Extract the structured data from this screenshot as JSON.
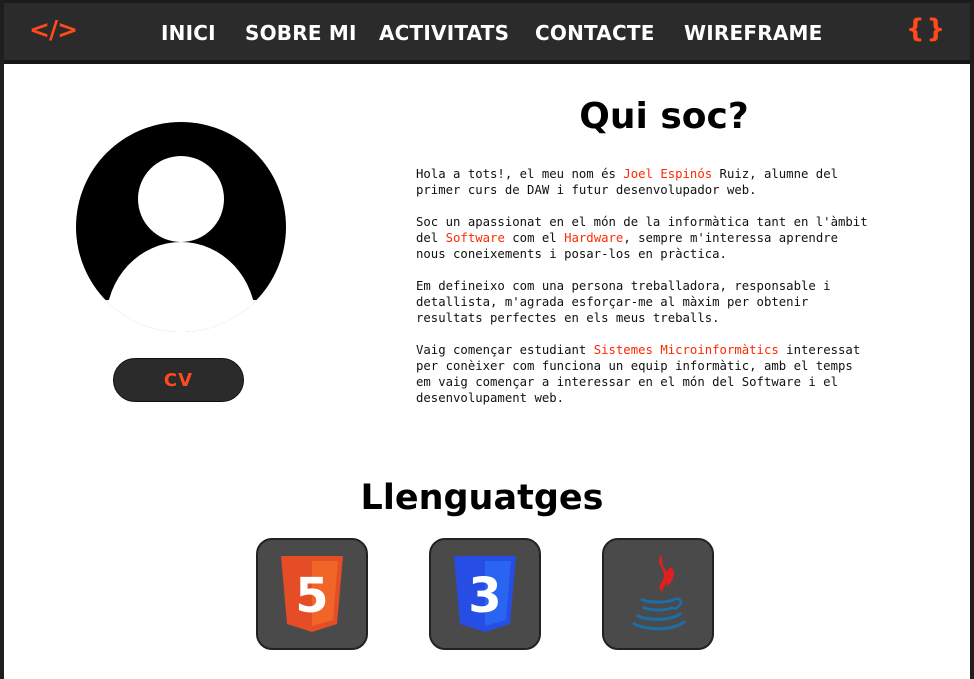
{
  "navbar": {
    "logo": "</>",
    "braces": "{}",
    "links": [
      "INICI",
      "SOBRE MI",
      "ACTIVITATS",
      "CONTACTE",
      "WIREFRAME"
    ]
  },
  "profile": {
    "cv_label": "CV"
  },
  "about": {
    "title": "Qui soc?",
    "p1": {
      "t1": "Hola a tots!, el meu nom és ",
      "name": "Joel Espinós",
      "t2": " Ruiz, alumne del",
      "line2": "primer curs de DAW i futur desenvolupador web."
    },
    "p2": {
      "line1": "Soc un apassionat en el món de la informàtica tant en l'àmbit",
      "t1": "del ",
      "software": "Software",
      "t2": " com el ",
      "hardware": "Hardware",
      "t3": ", sempre m'interessa aprendre",
      "line3": "nous coneixements i posar-los en pràctica."
    },
    "p3": {
      "line1": "Em defineixo com una persona treballadora, responsable i",
      "line2": "detallista, m'agrada esforçar-me al màxim per obtenir",
      "line3": "resultats perfectes en els meus treballs."
    },
    "p4": {
      "t1": "Vaig començar estudiant ",
      "highlight": "Sistemes Microinformàtics",
      "t2": " interessat",
      "line2": "per conèixer com funciona un equip informàtic, amb el temps",
      "line3": "em vaig començar a interessar en el món del Software i el",
      "line4": "desenvolupament web."
    }
  },
  "languages": {
    "title": "Llenguatges",
    "items": [
      {
        "icon": "html5-icon",
        "label": "5"
      },
      {
        "icon": "css3-icon",
        "label": "3"
      },
      {
        "icon": "java-icon"
      }
    ]
  },
  "colors": {
    "accent": "#ff4a1c",
    "navbar_bg": "#2b2b2b",
    "card_bg": "#4a4a4a",
    "html5": "#e44d26",
    "css3": "#264de4",
    "java_red": "#e11f21",
    "java_blue": "#1d6ea8"
  }
}
